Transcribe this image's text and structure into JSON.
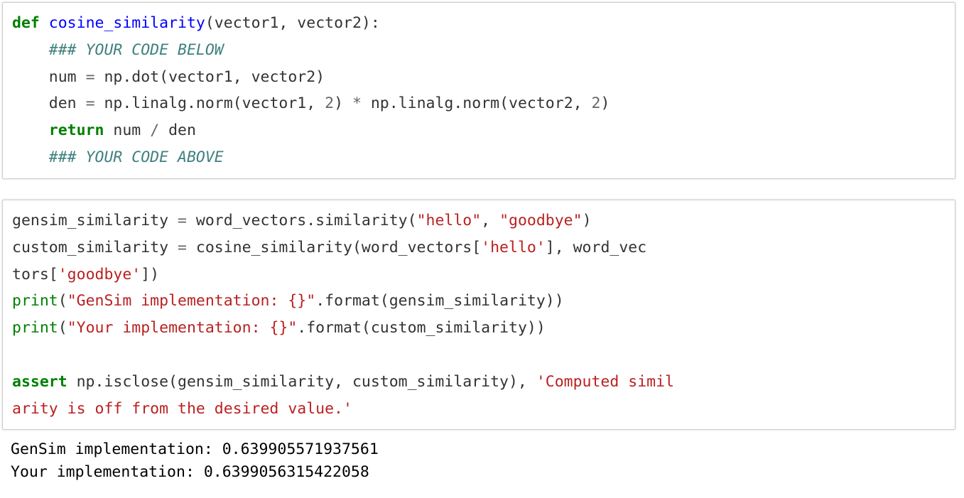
{
  "notebook": {
    "colors": {
      "keyword": "#008000",
      "function": "#0000FF",
      "string": "#BA2121",
      "comment": "#408080",
      "number": "#666666",
      "operator": "#666666",
      "plain_text": "#333333",
      "output_text": "#000000",
      "cell_border": "#cfcfcf",
      "cell_background": "#ffffff",
      "page_background": "#ffffff"
    },
    "cells": [
      {
        "id": "cell-1",
        "type": "code",
        "source": "def cosine_similarity(vector1, vector2):\n    ### YOUR CODE BELOW\n    num = np.dot(vector1, vector2)\n    den = np.linalg.norm(vector1, 2) * np.linalg.norm(vector2, 2)\n    return num / den\n    ### YOUR CODE ABOVE",
        "lines": [
          {
            "index": 1,
            "text": "def cosine_similarity(vector1, vector2):",
            "tokens": [
              {
                "t": "def",
                "c": "keyword"
              },
              {
                "t": " ",
                "c": "plain"
              },
              {
                "t": "cosine_similarity",
                "c": "function"
              },
              {
                "t": "(vector1, vector2):",
                "c": "plain"
              }
            ]
          },
          {
            "index": 2,
            "text": "    ### YOUR CODE BELOW",
            "tokens": [
              {
                "t": "    ",
                "c": "plain"
              },
              {
                "t": "### YOUR CODE BELOW",
                "c": "comment"
              }
            ]
          },
          {
            "index": 3,
            "text": "    num = np.dot(vector1, vector2)",
            "tokens": [
              {
                "t": "    num ",
                "c": "plain"
              },
              {
                "t": "=",
                "c": "operator"
              },
              {
                "t": " np.dot(vector1, vector2)",
                "c": "plain"
              }
            ]
          },
          {
            "index": 4,
            "text": "    den = np.linalg.norm(vector1, 2) * np.linalg.norm(vector2, 2)",
            "tokens": [
              {
                "t": "    den ",
                "c": "plain"
              },
              {
                "t": "=",
                "c": "operator"
              },
              {
                "t": " np.linalg.norm(vector1, ",
                "c": "plain"
              },
              {
                "t": "2",
                "c": "number"
              },
              {
                "t": ") ",
                "c": "plain"
              },
              {
                "t": "*",
                "c": "operator"
              },
              {
                "t": " np.linalg.norm(vector2, ",
                "c": "plain"
              },
              {
                "t": "2",
                "c": "number"
              },
              {
                "t": ")",
                "c": "plain"
              }
            ]
          },
          {
            "index": 5,
            "text": "    return num / den",
            "tokens": [
              {
                "t": "    ",
                "c": "plain"
              },
              {
                "t": "return",
                "c": "keyword"
              },
              {
                "t": " num ",
                "c": "plain"
              },
              {
                "t": "/",
                "c": "operator"
              },
              {
                "t": " den",
                "c": "plain"
              }
            ]
          },
          {
            "index": 6,
            "text": "    ### YOUR CODE ABOVE",
            "tokens": [
              {
                "t": "    ",
                "c": "plain"
              },
              {
                "t": "### YOUR CODE ABOVE",
                "c": "comment"
              }
            ]
          }
        ]
      },
      {
        "id": "cell-2",
        "type": "code",
        "source": "gensim_similarity = word_vectors.similarity(\"hello\", \"goodbye\")\ncustom_similarity = cosine_similarity(word_vectors['hello'], word_vectors['goodbye'])\nprint(\"GenSim implementation: {}\".format(gensim_similarity))\nprint(\"Your implementation: {}\".format(custom_similarity))\n\nassert np.isclose(gensim_similarity, custom_similarity), 'Computed similarity is off from the desired value.'",
        "lines": [
          {
            "index": 1,
            "text": "gensim_similarity = word_vectors.similarity(\"hello\", \"goodbye\")",
            "tokens": [
              {
                "t": "gensim_similarity ",
                "c": "plain"
              },
              {
                "t": "=",
                "c": "operator"
              },
              {
                "t": " word_vectors.similarity(",
                "c": "plain"
              },
              {
                "t": "\"hello\"",
                "c": "string"
              },
              {
                "t": ", ",
                "c": "plain"
              },
              {
                "t": "\"goodbye\"",
                "c": "string"
              },
              {
                "t": ")",
                "c": "plain"
              }
            ]
          },
          {
            "index": 2,
            "wrapped": true,
            "text": "custom_similarity = cosine_similarity(word_vectors['hello'], word_vectors['goodbye'])",
            "tokens": [
              {
                "t": "custom_similarity ",
                "c": "plain"
              },
              {
                "t": "=",
                "c": "operator"
              },
              {
                "t": " cosine_similarity(word_vectors[",
                "c": "plain"
              },
              {
                "t": "'hello'",
                "c": "string"
              },
              {
                "t": "], word_vectors[",
                "c": "plain"
              },
              {
                "t": "'goodbye'",
                "c": "string"
              },
              {
                "t": "])",
                "c": "plain"
              }
            ]
          },
          {
            "index": 3,
            "text": "print(\"GenSim implementation: {}\".format(gensim_similarity))",
            "tokens": [
              {
                "t": "print",
                "c": "builtin"
              },
              {
                "t": "(",
                "c": "plain"
              },
              {
                "t": "\"GenSim implementation: {}\"",
                "c": "string"
              },
              {
                "t": ".format(gensim_similarity))",
                "c": "plain"
              }
            ]
          },
          {
            "index": 4,
            "text": "print(\"Your implementation: {}\".format(custom_similarity))",
            "tokens": [
              {
                "t": "print",
                "c": "builtin"
              },
              {
                "t": "(",
                "c": "plain"
              },
              {
                "t": "\"Your implementation: {}\"",
                "c": "string"
              },
              {
                "t": ".format(custom_similarity))",
                "c": "plain"
              }
            ]
          },
          {
            "index": 5,
            "text": "",
            "tokens": []
          },
          {
            "index": 6,
            "wrapped": true,
            "text": "assert np.isclose(gensim_similarity, custom_similarity), 'Computed similarity is off from the desired value.'",
            "tokens": [
              {
                "t": "assert",
                "c": "keyword"
              },
              {
                "t": " np.isclose(gensim_similarity, custom_similarity), ",
                "c": "plain"
              },
              {
                "t": "'Computed similarity is off from the desired value.'",
                "c": "string"
              }
            ]
          }
        ]
      }
    ],
    "output": {
      "type": "stream",
      "lines": [
        "GenSim implementation: 0.639905571937561",
        "Your implementation: 0.6399056315422058"
      ],
      "values": {
        "gensim_implementation_label": "GenSim implementation:",
        "gensim_implementation_value": "0.639905571937561",
        "your_implementation_label": "Your implementation:",
        "your_implementation_value": "0.6399056315422058"
      }
    }
  }
}
